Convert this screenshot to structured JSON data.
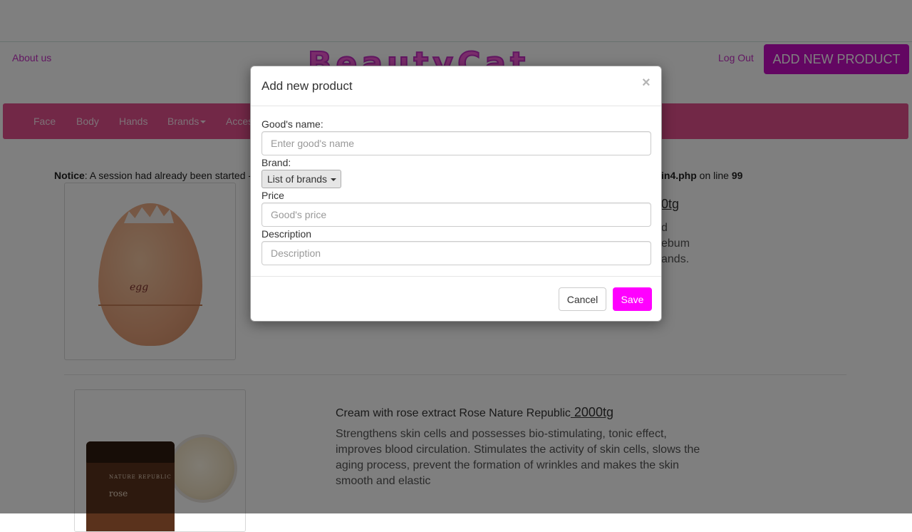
{
  "header": {
    "about_label": "About us",
    "logo_text": "BeautyCat",
    "logout_label": "Log Out",
    "add_new_product_label": "ADD NEW PRODUCT"
  },
  "nav": {
    "items": [
      "Face",
      "Body",
      "Hands",
      "Brands",
      "Acces"
    ]
  },
  "notice": {
    "label": "Notice",
    "text_left": ": A session had already been started -",
    "file_fragment": "in4.php",
    "line_text": " on line ",
    "line_number": "99"
  },
  "products": [
    {
      "image_label": "egg",
      "title_fragment": "0tg",
      "desc_lines": [
        "d",
        "ebum",
        "ands."
      ]
    },
    {
      "image_label_top": "NATURE REPUBLIC",
      "image_label_bottom": "rose",
      "title": "Cream with rose extract Rose Nature Republic",
      "price": " 2000tg",
      "description": "Strengthens skin cells and possesses bio-stimulating, tonic effect, improves blood circulation. Stimulates the activity of skin cells, slows the aging process, prevent the formation of wrinkles and makes the skin smooth and elastic"
    }
  ],
  "modal": {
    "title": "Add new product",
    "close_symbol": "×",
    "name_label": "Good's name:",
    "name_placeholder": "Enter good's name",
    "brand_label": "Brand:",
    "brand_button": "List of brands",
    "price_label": "Price",
    "price_placeholder": "Good's price",
    "description_label": "Description",
    "description_placeholder": "Description",
    "cancel_label": "Cancel",
    "save_label": "Save"
  },
  "colors": {
    "accent_magenta": "#ff00ff",
    "header_button": "#c70cc4",
    "navbar": "#e4508f"
  }
}
